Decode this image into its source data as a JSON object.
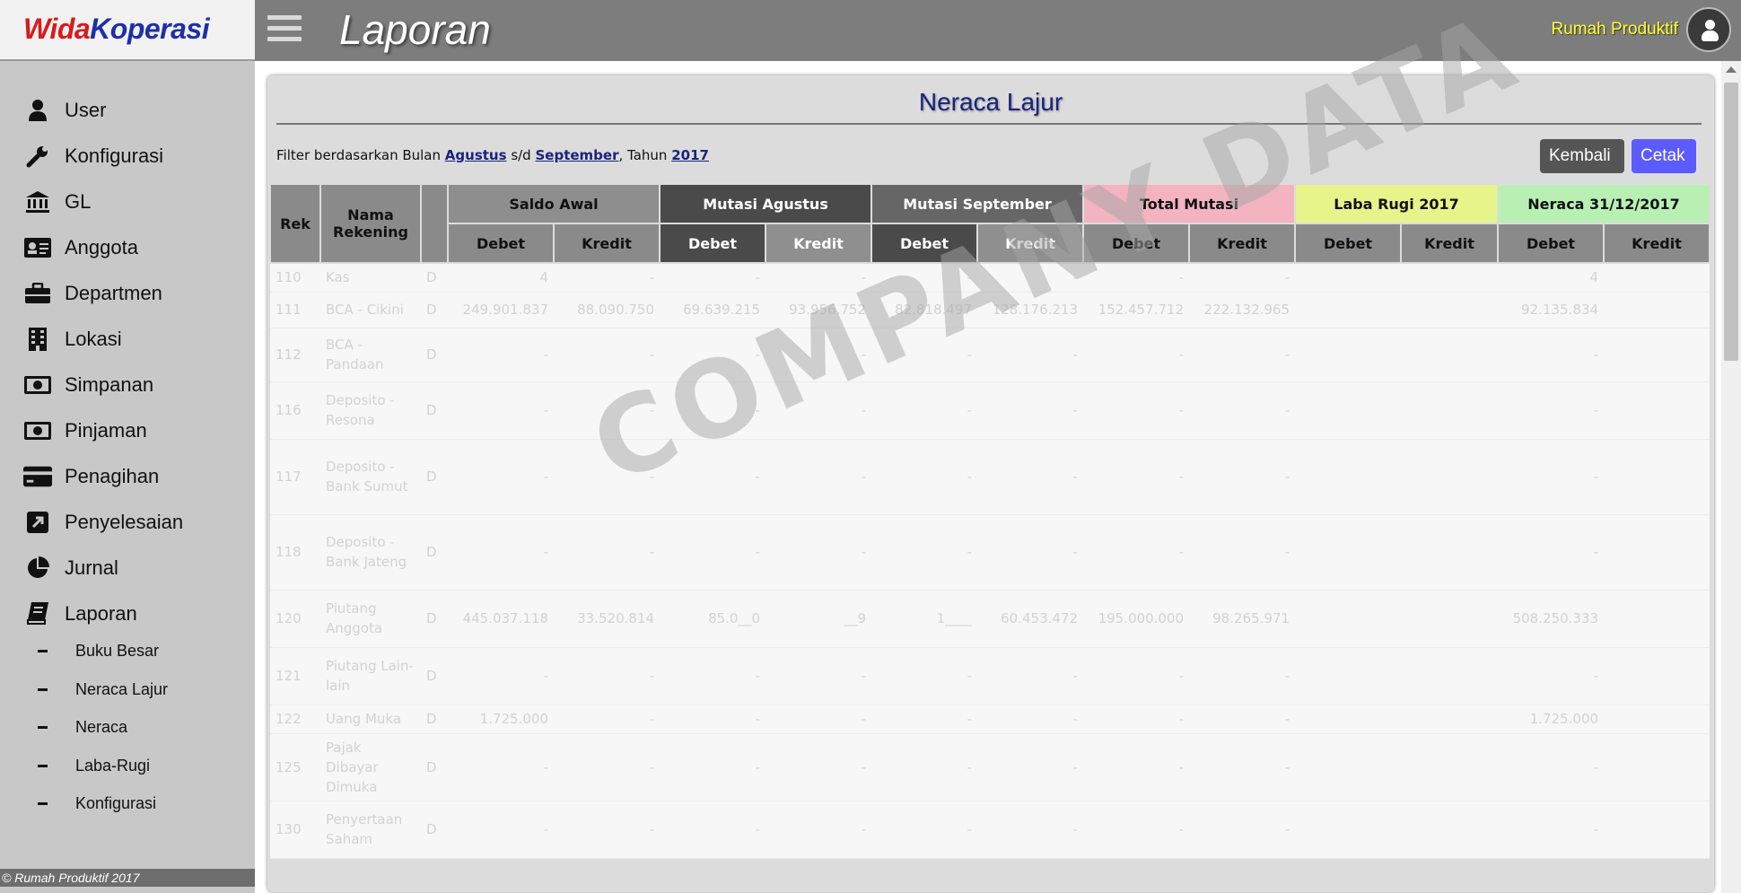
{
  "brand": {
    "part1": "Wida",
    "part2": "Koperasi"
  },
  "header": {
    "page_title": "Laporan",
    "org_name": "Rumah Produktif"
  },
  "sidebar": {
    "items": [
      {
        "label": "User",
        "icon": "user-icon"
      },
      {
        "label": "Konfigurasi",
        "icon": "wrench-icon"
      },
      {
        "label": "GL",
        "icon": "bank-icon"
      },
      {
        "label": "Anggota",
        "icon": "id-card-icon"
      },
      {
        "label": "Departmen",
        "icon": "briefcase-icon"
      },
      {
        "label": "Lokasi",
        "icon": "building-icon"
      },
      {
        "label": "Simpanan",
        "icon": "money-icon"
      },
      {
        "label": "Pinjaman",
        "icon": "money-icon"
      },
      {
        "label": "Penagihan",
        "icon": "credit-card-icon"
      },
      {
        "label": "Penyelesaian",
        "icon": "external-link-icon"
      },
      {
        "label": "Jurnal",
        "icon": "pie-chart-icon"
      },
      {
        "label": "Laporan",
        "icon": "book-icon"
      }
    ],
    "sub_items": [
      "Buku Besar",
      "Neraca Lajur",
      "Neraca",
      "Laba-Rugi",
      "Konfigurasi"
    ],
    "footer": "© Rumah Produktif 2017"
  },
  "report": {
    "title": "Neraca Lajur",
    "filter": {
      "prefix": "Filter berdasarkan Bulan",
      "from": "Agustus",
      "sep": "s/d",
      "to": "September",
      "year_prefix": ", Tahun",
      "year": "2017"
    },
    "buttons": {
      "back": "Kembali",
      "print": "Cetak"
    },
    "headers": {
      "rek": "Rek",
      "nama": "Nama Rekening",
      "groups": [
        "Saldo Awal",
        "Mutasi Agustus",
        "Mutasi September",
        "Total Mutasi",
        "Laba Rugi 2017",
        "Neraca 31/12/2017"
      ],
      "debet": "Debet",
      "kredit": "Kredit"
    },
    "rows": [
      {
        "rek": "110",
        "nama": "Kas",
        "dk": "D",
        "v": [
          "4",
          "-",
          "-",
          "-",
          "-",
          "-",
          "-",
          "-",
          "",
          "",
          "4",
          ""
        ]
      },
      {
        "rek": "111",
        "nama": "BCA - Cikini",
        "dk": "D",
        "v": [
          "249.901.837",
          "88.090.750",
          "69.639.215",
          "93.956.752",
          "82.818.497",
          "128.176.213",
          "152.457.712",
          "222.132.965",
          "",
          "",
          "92.135.834",
          ""
        ]
      },
      {
        "rek": "112",
        "nama": "BCA - Pandaan",
        "dk": "D",
        "v": [
          "-",
          "-",
          "-",
          "-",
          "-",
          "-",
          "-",
          "-",
          "",
          "",
          "-",
          ""
        ]
      },
      {
        "rek": "116",
        "nama": "Deposito - Resona",
        "dk": "D",
        "v": [
          "-",
          "-",
          "-",
          "-",
          "-",
          "-",
          "-",
          "-",
          "",
          "",
          "-",
          ""
        ]
      },
      {
        "rek": "117",
        "nama": "Deposito - Bank Sumut",
        "dk": "D",
        "v": [
          "-",
          "-",
          "-",
          "-",
          "-",
          "-",
          "-",
          "-",
          "",
          "",
          "-",
          ""
        ]
      },
      {
        "rek": "118",
        "nama": "Deposito - Bank Jateng",
        "dk": "D",
        "v": [
          "-",
          "-",
          "-",
          "-",
          "-",
          "-",
          "-",
          "-",
          "",
          "",
          "-",
          ""
        ]
      },
      {
        "rek": "120",
        "nama": "Piutang Anggota",
        "dk": "D",
        "v": [
          "445.037.118",
          "33.520.814",
          "85.0__0",
          "__9",
          "1____",
          "60.453.472",
          "195.000.000",
          "98.265.971",
          "",
          "",
          "508.250.333",
          ""
        ]
      },
      {
        "rek": "121",
        "nama": "Piutang Lain-lain",
        "dk": "D",
        "v": [
          "-",
          "-",
          "-",
          "-",
          "-",
          "-",
          "-",
          "-",
          "",
          "",
          "-",
          ""
        ]
      },
      {
        "rek": "122",
        "nama": "Uang Muka",
        "dk": "D",
        "v": [
          "1.725.000",
          "-",
          "-",
          "-",
          "-",
          "-",
          "-",
          "-",
          "",
          "",
          "1.725.000",
          ""
        ]
      },
      {
        "rek": "125",
        "nama": "Pajak Dibayar Dimuka",
        "dk": "D",
        "v": [
          "-",
          "-",
          "-",
          "-",
          "-",
          "-",
          "-",
          "-",
          "",
          "",
          "-",
          ""
        ]
      },
      {
        "rek": "130",
        "nama": "Penyertaan Saham",
        "dk": "D",
        "v": [
          "-",
          "-",
          "-",
          "-",
          "-",
          "-",
          "-",
          "-",
          "",
          "",
          "-",
          ""
        ]
      }
    ]
  },
  "watermark": "COMPANY DATA",
  "colors": {
    "brand_red": "#d81b1b",
    "brand_blue": "#1d2fa8",
    "org_yellow": "#ffff33",
    "print_button": "#5b5bff"
  }
}
